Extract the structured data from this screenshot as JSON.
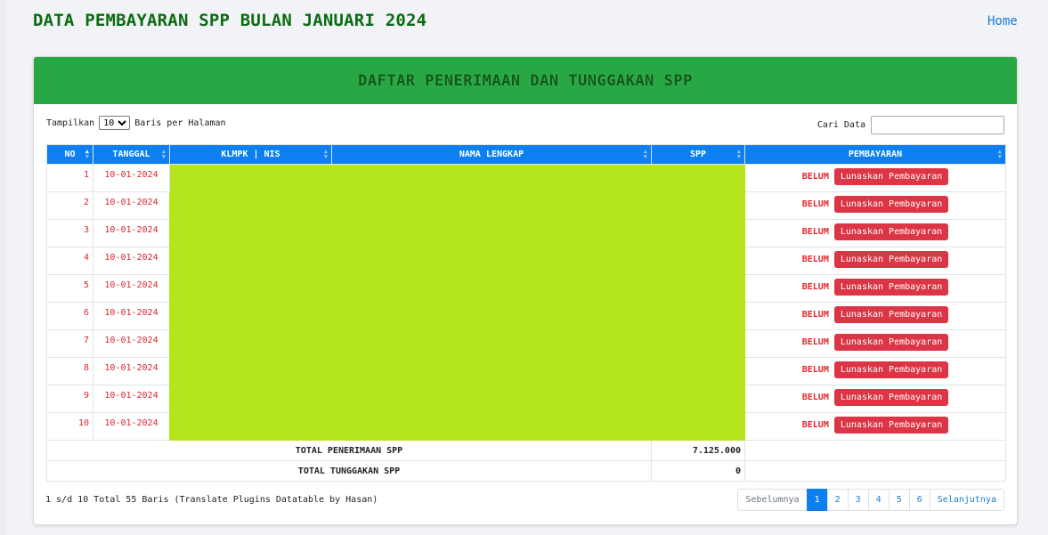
{
  "page_title": "DATA PEMBAYARAN SPP BULAN JANUARI 2024",
  "nav": {
    "home": "Home"
  },
  "card": {
    "title": "DAFTAR PENERIMAAN DAN TUNGGAKAN SPP"
  },
  "length_control": {
    "prefix": "Tampilkan",
    "value": "10",
    "suffix": "Baris per Halaman",
    "options": [
      "10"
    ]
  },
  "search": {
    "label": "Cari Data",
    "value": ""
  },
  "table": {
    "columns": [
      "NO",
      "TANGGAL",
      "KLMPK | NIS",
      "NAMA LENGKAP",
      "SPP",
      "PEMBAYARAN"
    ],
    "rows": [
      {
        "no": "1",
        "tanggal": "10-01-2024",
        "status": "BELUM",
        "action": "Lunaskan Pembayaran"
      },
      {
        "no": "2",
        "tanggal": "10-01-2024",
        "status": "BELUM",
        "action": "Lunaskan Pembayaran"
      },
      {
        "no": "3",
        "tanggal": "10-01-2024",
        "status": "BELUM",
        "action": "Lunaskan Pembayaran"
      },
      {
        "no": "4",
        "tanggal": "10-01-2024",
        "status": "BELUM",
        "action": "Lunaskan Pembayaran"
      },
      {
        "no": "5",
        "tanggal": "10-01-2024",
        "status": "BELUM",
        "action": "Lunaskan Pembayaran"
      },
      {
        "no": "6",
        "tanggal": "10-01-2024",
        "status": "BELUM",
        "action": "Lunaskan Pembayaran"
      },
      {
        "no": "7",
        "tanggal": "10-01-2024",
        "status": "BELUM",
        "action": "Lunaskan Pembayaran"
      },
      {
        "no": "8",
        "tanggal": "10-01-2024",
        "status": "BELUM",
        "action": "Lunaskan Pembayaran"
      },
      {
        "no": "9",
        "tanggal": "10-01-2024",
        "status": "BELUM",
        "action": "Lunaskan Pembayaran"
      },
      {
        "no": "10",
        "tanggal": "10-01-2024",
        "status": "BELUM",
        "action": "Lunaskan Pembayaran"
      }
    ],
    "footer": [
      {
        "label": "TOTAL PENERIMAAN SPP",
        "value": "7.125.000"
      },
      {
        "label": "TOTAL TUNGGAKAN SPP",
        "value": "0"
      }
    ]
  },
  "info": "1 s/d 10 Total 55 Baris (Translate Plugins Datatable by Hasan)",
  "pagination": {
    "prev": "Sebelumnya",
    "pages": [
      "1",
      "2",
      "3",
      "4",
      "5",
      "6"
    ],
    "active": "1",
    "next": "Selanjutnya"
  },
  "colors": {
    "header_green": "#28a745",
    "table_header_blue": "#0d7ff0",
    "redacted": "#b5e61d",
    "danger": "#dc3545"
  }
}
